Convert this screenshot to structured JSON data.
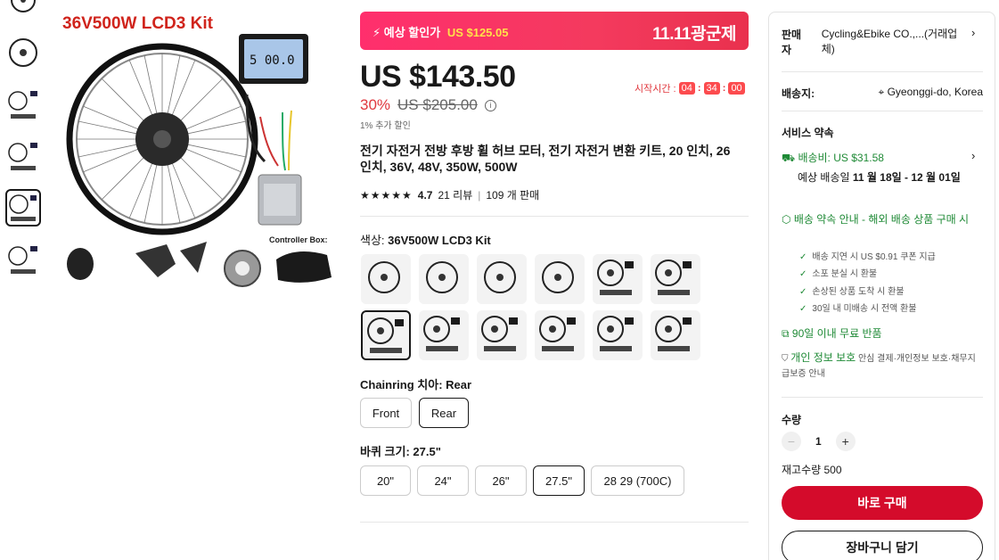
{
  "gallery": {
    "image_title": "36V500W LCD3 Kit",
    "controller_label": "Controller Box:"
  },
  "banner": {
    "label": "예상 할인가",
    "amount": "US $125.05",
    "event": "11.11광군제"
  },
  "price": {
    "current": "US $143.50",
    "discount": "30%",
    "original": "US $205.00",
    "extra": "1% 추가 할인"
  },
  "timer": {
    "label": "시작시간 :",
    "hours": "04",
    "minutes": "34",
    "seconds": "00"
  },
  "product": {
    "title": "전기 자전거 전방 후방 휠 허브 모터, 전기 자전거 변환 키트, 20 인치, 26 인치, 36V, 48V, 350W, 500W",
    "rating_stars": "★★★★★",
    "rating": "4.7",
    "reviews": "21 리뷰",
    "sold": "109 개 판매"
  },
  "options": {
    "color": {
      "label": "색상:",
      "value": "36V500W LCD3 Kit",
      "swatch_count": 12,
      "selected_index": 6
    },
    "chainring": {
      "label": "Chainring 치아:",
      "value": "Rear",
      "choices": [
        "Front",
        "Rear"
      ],
      "selected_index": 1
    },
    "wheel": {
      "label": "바퀴 크기:",
      "value": "27.5\"",
      "choices": [
        "20\"",
        "24\"",
        "26\"",
        "27.5\"",
        "28 29 (700C)"
      ],
      "selected_index": 3
    }
  },
  "panel": {
    "seller_label": "판매자",
    "seller_name": "Cycling&Ebike CO.,...(거래업체)",
    "ship_from_label": "배송지:",
    "ship_from": "Gyeonggi-do, Korea",
    "service_title": "서비스 약속",
    "shipping_fee": "배송비: US $31.58",
    "delivery_label": "예상 배송일",
    "delivery_date": "11 월 18일 - 12 월 01일",
    "promise_title": "배송 약속 안내 - 해외 배송 상품 구매 시",
    "promise_items": [
      "배송 지연 시 US $0.91 쿠폰 지급",
      "소포 분실 시 환불",
      "손상된 상품 도착 시 환불",
      "30일 내 미배송 시 전액 환불"
    ],
    "returns": "90일 이내 무료 반품",
    "privacy_title": "개인 정보 보호",
    "privacy_desc": "안심 결제·개인정보 보호·채무지급보증 안내",
    "qty_label": "수량",
    "qty_value": "1",
    "stock": "재고수량 500",
    "buy_now": "바로 구매",
    "add_cart": "장바구니 담기"
  },
  "colors": {
    "accent_red": "#d40b2b",
    "banner_pink": "#ff2f6d",
    "green": "#1f8a36"
  }
}
